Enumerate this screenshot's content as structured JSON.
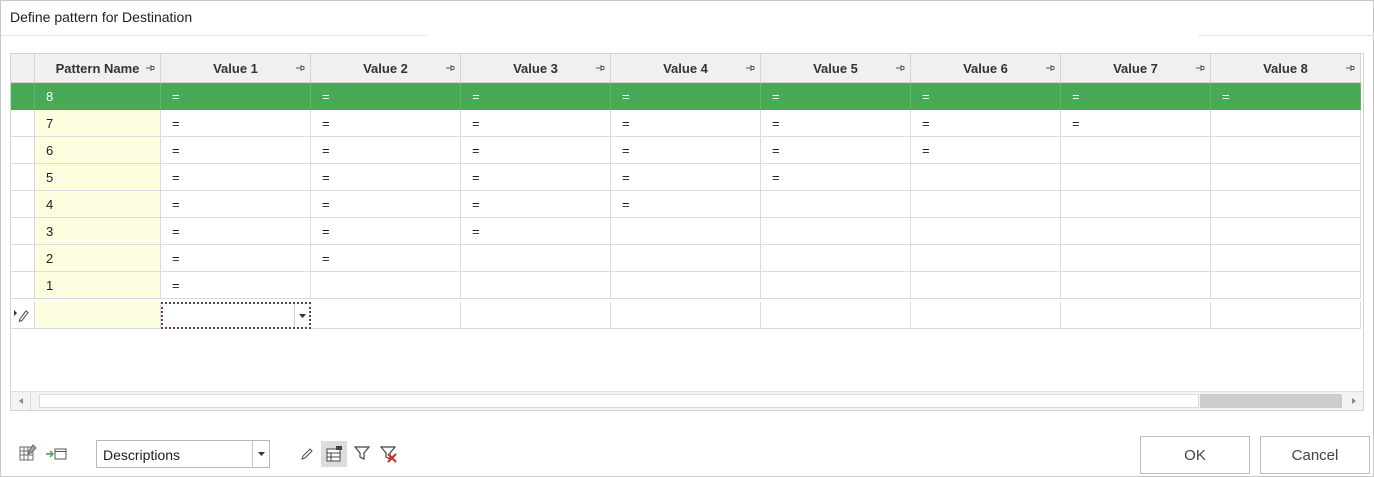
{
  "window": {
    "title": "Define pattern for Destination"
  },
  "grid": {
    "columns": [
      "Pattern Name",
      "Value 1",
      "Value 2",
      "Value 3",
      "Value 4",
      "Value 5",
      "Value 6",
      "Value 7",
      "Value 8"
    ],
    "rows": [
      {
        "name": "8",
        "values": [
          "=",
          "=",
          "=",
          "=",
          "=",
          "=",
          "=",
          "="
        ]
      },
      {
        "name": "7",
        "values": [
          "=",
          "=",
          "=",
          "=",
          "=",
          "=",
          "=",
          ""
        ]
      },
      {
        "name": "6",
        "values": [
          "=",
          "=",
          "=",
          "=",
          "=",
          "=",
          "",
          ""
        ]
      },
      {
        "name": "5",
        "values": [
          "=",
          "=",
          "=",
          "=",
          "=",
          "",
          "",
          ""
        ]
      },
      {
        "name": "4",
        "values": [
          "=",
          "=",
          "=",
          "=",
          "",
          "",
          "",
          ""
        ]
      },
      {
        "name": "3",
        "values": [
          "=",
          "=",
          "=",
          "",
          "",
          "",
          "",
          ""
        ]
      },
      {
        "name": "2",
        "values": [
          "=",
          "=",
          "",
          "",
          "",
          "",
          "",
          ""
        ]
      },
      {
        "name": "1",
        "values": [
          "=",
          "",
          "",
          "",
          "",
          "",
          "",
          ""
        ]
      }
    ],
    "selected_row": "8",
    "new_row_indicator": "edit-pencil-icon"
  },
  "toolbar": {
    "view_select_value": "Descriptions",
    "icons": [
      "grid-settings-icon",
      "export-icon",
      "edit-pencil-icon",
      "column-chooser-icon",
      "filter-icon",
      "clear-filter-icon"
    ]
  },
  "buttons": {
    "ok": "OK",
    "cancel": "Cancel"
  },
  "colors": {
    "selected_row": "#48a957",
    "name_column": "#fdfde0",
    "header": "#f0f0f0"
  }
}
